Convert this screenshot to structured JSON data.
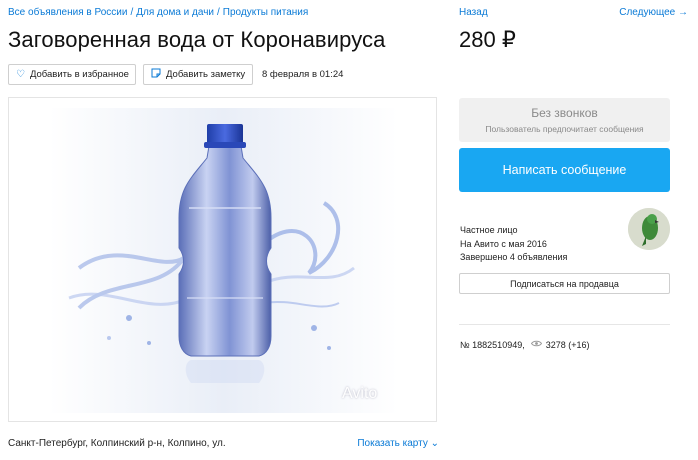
{
  "breadcrumb": {
    "items": [
      "Все объявления в России",
      "Для дома и дачи",
      "Продукты питания"
    ],
    "separator": "/"
  },
  "nav": {
    "back": "Назад",
    "next": "Следующее →"
  },
  "listing": {
    "title": "Заговоренная вода от Коронавируса",
    "price": "280 ₽",
    "date": "8 февраля в 01:24",
    "address": "Санкт-Петербург, Колпинский р-н, Колпино, ул.",
    "show_map": "Показать карту ⌄",
    "photo": {
      "icon": "water-bottle-photo",
      "watermark": "Avito"
    }
  },
  "actions": {
    "favorite": {
      "label": "Добавить в избранное",
      "icon": "heart-icon"
    },
    "note": {
      "label": "Добавить заметку",
      "icon": "note-icon"
    }
  },
  "contact": {
    "no_calls_title": "Без звонков",
    "no_calls_subtitle": "Пользователь предпочитает сообщения",
    "write_button": "Написать сообщение",
    "accent_color": "#19a7f2"
  },
  "seller": {
    "type": "Частное лицо",
    "since": "На Авито с мая 2016",
    "completed": "Завершено 4 объявления",
    "subscribe": "Подписаться на продавца"
  },
  "stats": {
    "id_text": "№ 1882510949,",
    "views": "3278 (+16)",
    "views_icon": "eye-icon"
  }
}
